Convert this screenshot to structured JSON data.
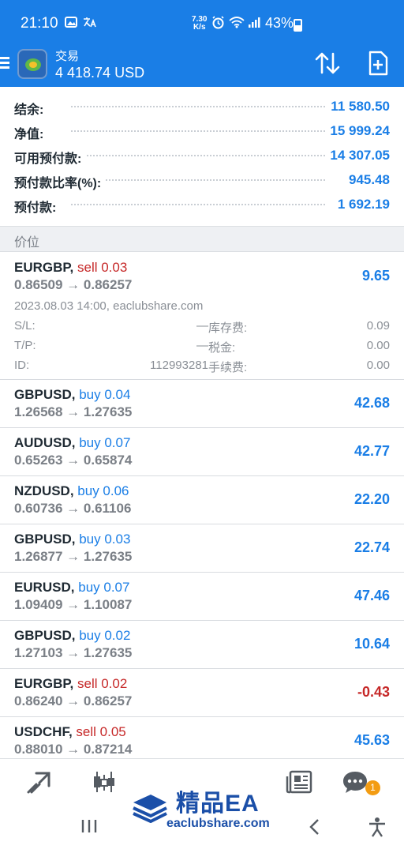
{
  "status_bar": {
    "time": "21:10",
    "net_speed_value": "7.30",
    "net_speed_unit": "K/s",
    "battery": "43%"
  },
  "header": {
    "title": "交易",
    "balance": "4 418.74 USD"
  },
  "summary": [
    {
      "label": "结余:",
      "value": "11 580.50"
    },
    {
      "label": "净值:",
      "value": "15 999.24"
    },
    {
      "label": "可用预付款:",
      "value": "14 307.05"
    },
    {
      "label": "预付款比率(%):",
      "value": "945.48"
    },
    {
      "label": "预付款:",
      "value": "1 692.19"
    }
  ],
  "section_title": "价位",
  "positions": [
    {
      "symbol": "EURGBP,",
      "direction": "sell",
      "volume": "sell 0.03",
      "prices": "0.86509 → 0.86257",
      "profit": "9.65"
    },
    {
      "symbol": "GBPUSD,",
      "direction": "buy",
      "volume": "buy 0.04",
      "prices": "1.26568 → 1.27635",
      "profit": "42.68"
    },
    {
      "symbol": "AUDUSD,",
      "direction": "buy",
      "volume": "buy 0.07",
      "prices": "0.65263 → 0.65874",
      "profit": "42.77"
    },
    {
      "symbol": "NZDUSD,",
      "direction": "buy",
      "volume": "buy 0.06",
      "prices": "0.60736 → 0.61106",
      "profit": "22.20"
    },
    {
      "symbol": "GBPUSD,",
      "direction": "buy",
      "volume": "buy 0.03",
      "prices": "1.26877 → 1.27635",
      "profit": "22.74"
    },
    {
      "symbol": "EURUSD,",
      "direction": "buy",
      "volume": "buy 0.07",
      "prices": "1.09409 → 1.10087",
      "profit": "47.46"
    },
    {
      "symbol": "GBPUSD,",
      "direction": "buy",
      "volume": "buy 0.02",
      "prices": "1.27103 → 1.27635",
      "profit": "10.64"
    },
    {
      "symbol": "EURGBP,",
      "direction": "sell",
      "volume": "sell 0.02",
      "prices": "0.86240 → 0.86257",
      "profit": "-0.43"
    },
    {
      "symbol": "USDCHF,",
      "direction": "sell",
      "volume": "sell 0.05",
      "prices": "0.88010 → 0.87214",
      "profit": "45.63"
    }
  ],
  "expanded_detail": {
    "open_time": "2023.08.03 14:00, eaclubshare.com",
    "sl_label": "S/L:",
    "sl_value": "—",
    "swap_label": "库存费:",
    "swap_value": "0.09",
    "tp_label": "T/P:",
    "tp_value": "—",
    "tax_label": "税金:",
    "tax_value": "0.00",
    "id_label": "ID:",
    "id_value": "112993281",
    "fee_label": "手续费:",
    "fee_value": "0.00"
  },
  "bottom_nav": {
    "chat_badge": "1",
    "icons": [
      "quotes-icon",
      "charts-icon",
      "trade-icon",
      "history-icon",
      "messages-icon"
    ]
  },
  "watermark": {
    "title": "精品EA",
    "url": "eaclubshare.com"
  },
  "colors": {
    "accent": "#1a7ee6",
    "sell": "#c62828",
    "badge": "#f39c12"
  }
}
